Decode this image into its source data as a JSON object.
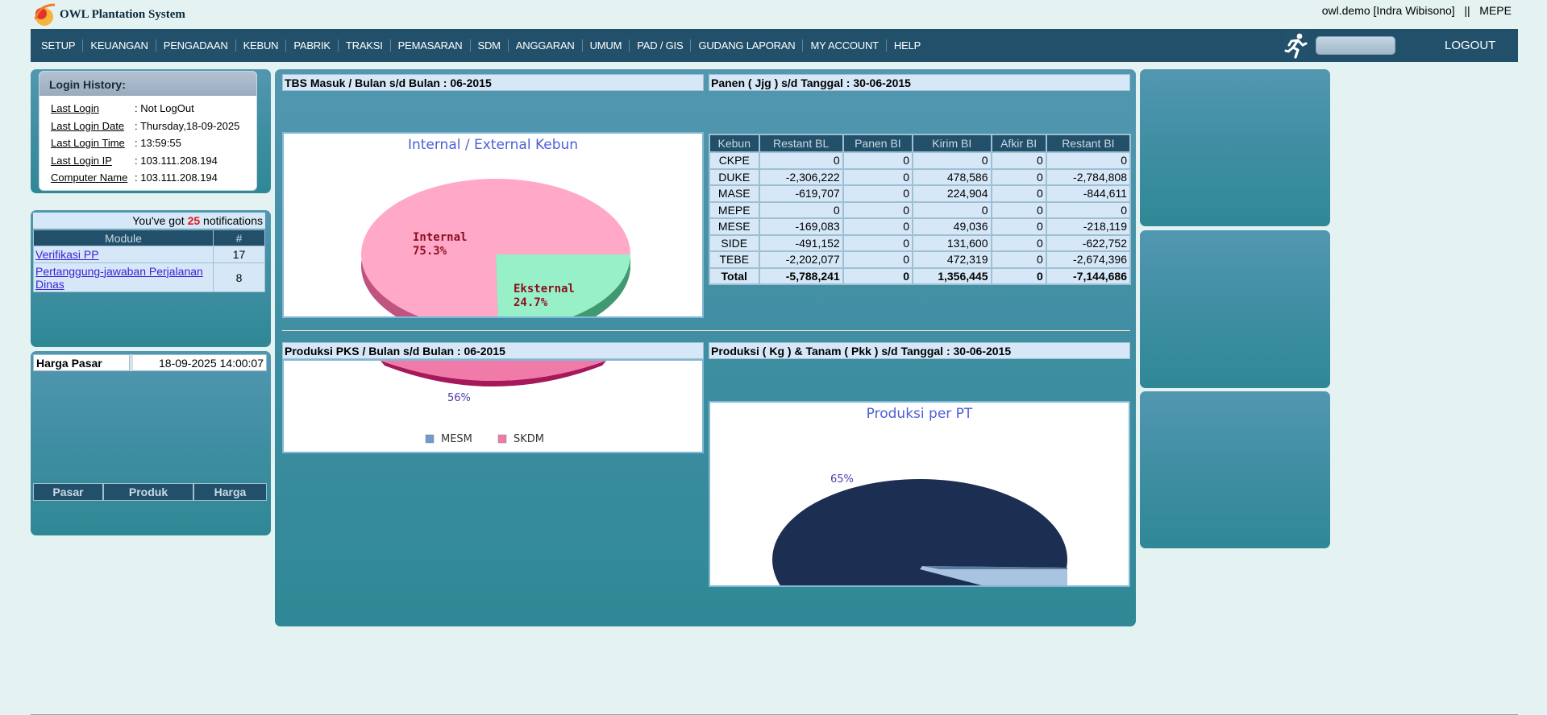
{
  "header": {
    "app_title": "OWL Plantation System",
    "user_info": "owl.demo [Indra Wibisono]   ||   MEPE"
  },
  "menu": {
    "items": [
      "SETUP",
      "KEUANGAN",
      "PENGADAAN",
      "KEBUN",
      "PABRIK",
      "TRAKSI",
      "PEMASARAN",
      "SDM",
      "ANGGARAN",
      "UMUM",
      "PAD / GIS",
      "GUDANG LAPORAN",
      "MY ACCOUNT",
      "HELP"
    ],
    "logout_label": "LOGOUT",
    "search_placeholder": ""
  },
  "login_history": {
    "title": "Login History:",
    "rows": [
      {
        "label": "Last Login",
        "value": ": Not LogOut"
      },
      {
        "label": "Last Login Date",
        "value": ": Thursday,18-09-2025"
      },
      {
        "label": "Last Login Time",
        "value": ": 13:59:55"
      },
      {
        "label": "Last Login IP",
        "value": ": 103.111.208.194"
      },
      {
        "label": "Computer Name",
        "value": ": 103.111.208.194"
      }
    ]
  },
  "notifications": {
    "prefix": "You've got ",
    "count": "25",
    "suffix": " notifications",
    "col_module": "Module",
    "col_count": "#",
    "rows": [
      {
        "module": "Verifikasi PP",
        "count": "17"
      },
      {
        "module": "Pertanggung-jawaban Perjalanan Dinas",
        "count": "8"
      }
    ]
  },
  "harga_pasar": {
    "title": "Harga Pasar",
    "datetime": "18-09-2025 14:00:07",
    "columns": [
      "Pasar",
      "Produk",
      "Harga"
    ]
  },
  "sections": {
    "tbs_title": "TBS Masuk / Bulan s/d Bulan : 06-2015",
    "panen_title": "Panen ( Jjg ) s/d Tanggal : 30-06-2015",
    "pks_title": "Produksi PKS / Bulan s/d Bulan : 06-2015",
    "produksi_title": "Produksi ( Kg ) & Tanam ( Pkk ) s/d Tanggal : 30-06-2015"
  },
  "chart_data": [
    {
      "type": "pie",
      "title": "Internal / External Kebun",
      "categories": [
        "Internal",
        "Eksternal"
      ],
      "values": [
        75.3,
        24.7
      ],
      "labels": [
        "Internal\n75.3%",
        "Eksternal\n24.7%"
      ],
      "colors": [
        "#ffa8c8",
        "#98f0c8"
      ]
    },
    {
      "type": "pie",
      "title": "",
      "categories": [
        "MESM",
        "SKDM"
      ],
      "values": [
        44,
        56
      ],
      "labels": [
        "56%"
      ],
      "legend": [
        "MESM",
        "SKDM"
      ],
      "colors": [
        "#6f9ad0",
        "#f07aa8"
      ]
    },
    {
      "type": "pie",
      "title": "Produksi per PT",
      "labels": [
        "65%"
      ],
      "values": [
        65,
        35
      ],
      "colors": [
        "#1c2e52",
        "#a8c4e0"
      ]
    }
  ],
  "panen_table": {
    "columns": [
      "Kebun",
      "Restant BL",
      "Panen BI",
      "Kirim BI",
      "Afkir BI",
      "Restant BI"
    ],
    "rows": [
      [
        "CKPE",
        "0",
        "0",
        "0",
        "0",
        "0"
      ],
      [
        "DUKE",
        "-2,306,222",
        "0",
        "478,586",
        "0",
        "-2,784,808"
      ],
      [
        "MASE",
        "-619,707",
        "0",
        "224,904",
        "0",
        "-844,611"
      ],
      [
        "MEPE",
        "0",
        "0",
        "0",
        "0",
        "0"
      ],
      [
        "MESE",
        "-169,083",
        "0",
        "49,036",
        "0",
        "-218,119"
      ],
      [
        "SIDE",
        "-491,152",
        "0",
        "131,600",
        "0",
        "-622,752"
      ],
      [
        "TEBE",
        "-2,202,077",
        "0",
        "472,319",
        "0",
        "-2,674,396"
      ]
    ],
    "total": [
      "Total",
      "-5,788,241",
      "0",
      "1,356,445",
      "0",
      "-7,144,686"
    ]
  }
}
